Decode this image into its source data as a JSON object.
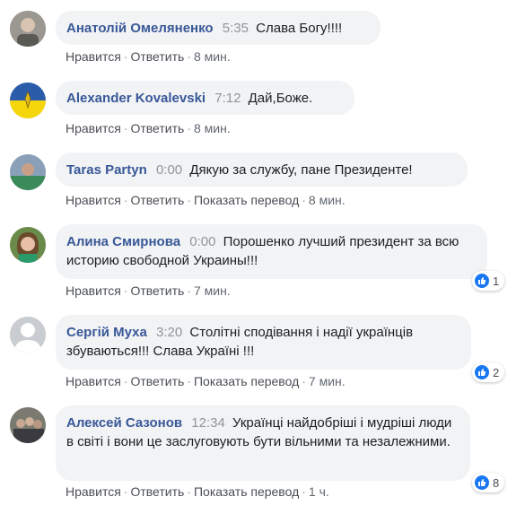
{
  "actions": {
    "like": "Нравится",
    "reply": "Ответить",
    "translate": "Показать перевод",
    "sep": "·"
  },
  "colors": {
    "author": "#385898",
    "bubble": "#f2f3f5",
    "like_badge": "#1877f2"
  },
  "comments": [
    {
      "author": "Анатолій Омеляненко",
      "time": "5:35",
      "text": "Слава Богу!!!!",
      "age": "8 мин."
    },
    {
      "author": "Alexander Kovalevski",
      "time": "7:12",
      "text": "Дай,Боже.",
      "age": "8 мин."
    },
    {
      "author": "Taras Partyn",
      "time": "0:00",
      "text": "Дякую за службу, пане Президенте!",
      "age": "8 мин."
    },
    {
      "author": "Алина Смирнова",
      "time": "0:00",
      "text": "Порошенко лучший президент за всю историю свободной Украины!!!",
      "age": "7 мин.",
      "likes": "1"
    },
    {
      "author": "Сергій Муха",
      "time": "3:20",
      "text": "Столітні сподівання і надії українців збуваються!!! Слава Україні !!!",
      "age": "7 мин.",
      "likes": "2"
    },
    {
      "author": "Алексей Сазонов",
      "time": "12:34",
      "text": "Українці найдобріші і мудріші люди в світі і вони це заслуговують бути вільними та незалежними.",
      "age": "1 ч.",
      "likes": "8"
    }
  ]
}
